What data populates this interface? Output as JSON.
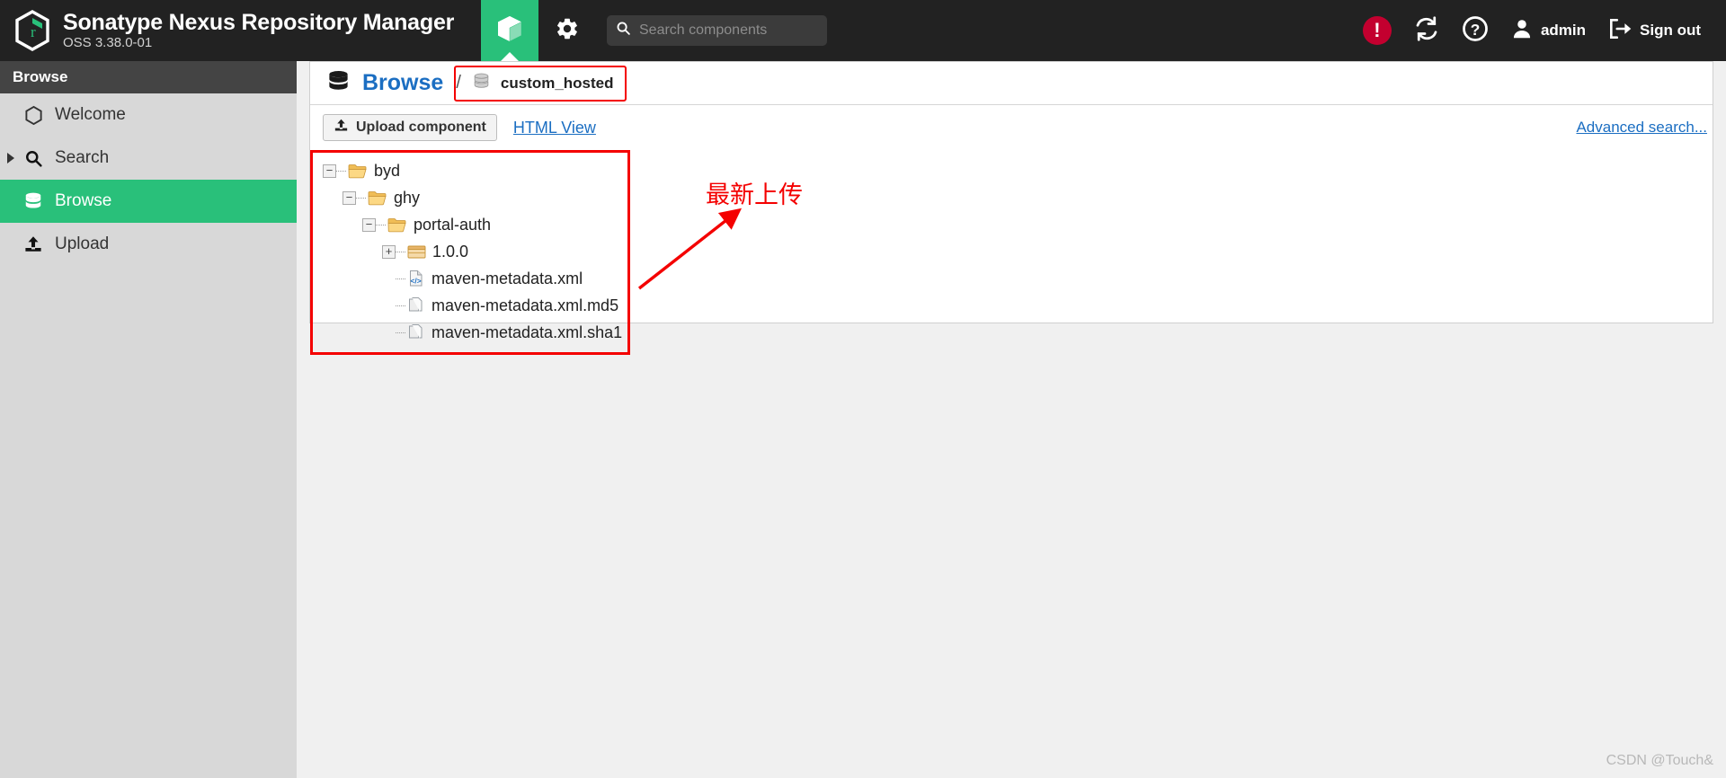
{
  "header": {
    "brand_title": "Sonatype Nexus Repository Manager",
    "brand_subtitle": "OSS 3.38.0-01",
    "browse_tab_icon": "cube-icon",
    "settings_icon": "gear-icon",
    "search": {
      "placeholder": "Search components",
      "value": "",
      "icon": "search-icon"
    },
    "alert_icon": "alert-exclamation-icon",
    "alert_symbol": "!",
    "refresh_icon": "refresh-icon",
    "help_icon": "help-question-icon",
    "user_icon": "user-avatar-icon",
    "user_label": "admin",
    "signout_icon": "sign-out-icon",
    "signout_label": "Sign out"
  },
  "sidebar": {
    "header": "Browse",
    "items": [
      {
        "label": "Welcome",
        "icon": "hexagon-icon",
        "active": false,
        "expandable": false
      },
      {
        "label": "Search",
        "icon": "search-icon",
        "active": false,
        "expandable": true
      },
      {
        "label": "Browse",
        "icon": "database-icon",
        "active": true,
        "expandable": false
      },
      {
        "label": "Upload",
        "icon": "upload-icon",
        "active": false,
        "expandable": false
      }
    ]
  },
  "main": {
    "breadcrumb": {
      "root_icon": "database-icon",
      "root_label": "Browse",
      "separator": "/",
      "repo_icon": "repository-icon",
      "repo_label": "custom_hosted"
    },
    "toolbar": {
      "upload_icon": "upload-icon",
      "upload_label": "Upload component",
      "html_view_label": "HTML View",
      "advanced_search_label": "Advanced search..."
    },
    "tree": [
      {
        "label": "byd",
        "icon": "folder-open-icon",
        "control": "−",
        "depth": 0
      },
      {
        "label": "ghy",
        "icon": "folder-open-icon",
        "control": "−",
        "depth": 1
      },
      {
        "label": "portal-auth",
        "icon": "folder-open-icon",
        "control": "−",
        "depth": 2
      },
      {
        "label": "1.0.0",
        "icon": "package-icon",
        "control": "+",
        "depth": 3
      },
      {
        "label": "maven-metadata.xml",
        "icon": "xml-file-icon",
        "control": "",
        "depth": 3
      },
      {
        "label": "maven-metadata.xml.md5",
        "icon": "copy-file-icon",
        "control": "",
        "depth": 3
      },
      {
        "label": "maven-metadata.xml.sha1",
        "icon": "copy-file-icon",
        "control": "",
        "depth": 3
      }
    ],
    "annotation": {
      "text": "最新上传",
      "color": "#f40000",
      "arrow_icon": "arrow-up-right-icon"
    },
    "watermark": "CSDN @Touch&"
  },
  "colors": {
    "accent_green": "#29c07a",
    "link_blue": "#1b6ec2",
    "header_dark": "#222222",
    "sidebar_gray": "#d8d8d8",
    "annotation_red": "#f40000",
    "alert_red": "#c3002f"
  }
}
